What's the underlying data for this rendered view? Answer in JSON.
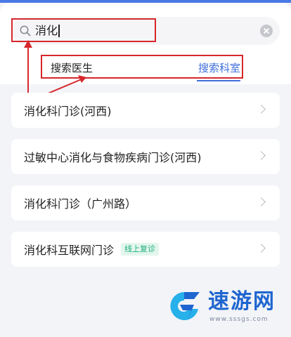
{
  "search": {
    "query": "消化"
  },
  "tabs": [
    {
      "label": "搜索医生"
    },
    {
      "label": "搜索科室"
    }
  ],
  "results": [
    {
      "title": "消化科门诊(河西)"
    },
    {
      "title": "过敏中心消化与食物疾病门诊(河西)"
    },
    {
      "title": "消化科门诊（广州路）"
    },
    {
      "title": "消化科互联网门诊",
      "tag": "线上复诊"
    }
  ],
  "watermark": {
    "title": "速游网",
    "url": "www.sssgs.com"
  },
  "colors": {
    "accent": "#3f6fdc",
    "annotation": "#d6272c",
    "tag": "#1fae7c"
  }
}
